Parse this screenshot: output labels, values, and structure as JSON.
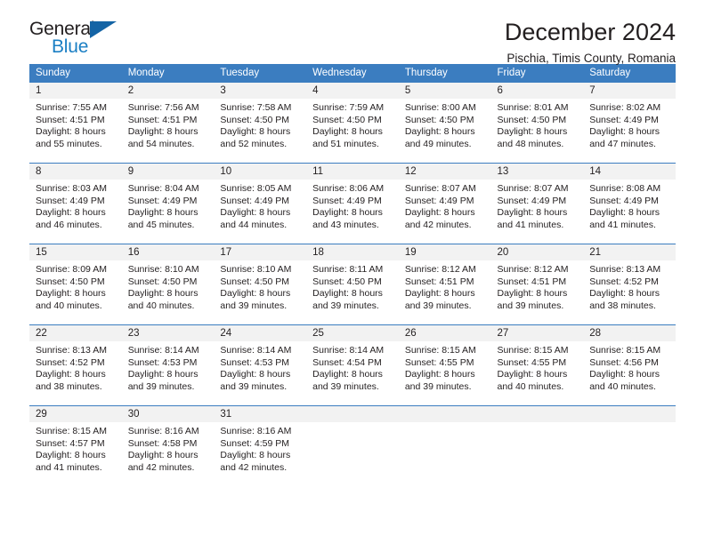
{
  "brand": {
    "name_primary": "General",
    "name_secondary": "Blue",
    "triangle_color": "#1464a5"
  },
  "header": {
    "title": "December 2024",
    "subtitle": "Pischia, Timis County, Romania"
  },
  "theme": {
    "header_bar_color": "#3b7dc0",
    "daynum_band_color": "#f2f2f2",
    "text_color": "#231f20"
  },
  "weekdays": [
    "Sunday",
    "Monday",
    "Tuesday",
    "Wednesday",
    "Thursday",
    "Friday",
    "Saturday"
  ],
  "weeks": [
    [
      {
        "day": "1",
        "sunrise": "Sunrise: 7:55 AM",
        "sunset": "Sunset: 4:51 PM",
        "daylight1": "Daylight: 8 hours",
        "daylight2": "and 55 minutes."
      },
      {
        "day": "2",
        "sunrise": "Sunrise: 7:56 AM",
        "sunset": "Sunset: 4:51 PM",
        "daylight1": "Daylight: 8 hours",
        "daylight2": "and 54 minutes."
      },
      {
        "day": "3",
        "sunrise": "Sunrise: 7:58 AM",
        "sunset": "Sunset: 4:50 PM",
        "daylight1": "Daylight: 8 hours",
        "daylight2": "and 52 minutes."
      },
      {
        "day": "4",
        "sunrise": "Sunrise: 7:59 AM",
        "sunset": "Sunset: 4:50 PM",
        "daylight1": "Daylight: 8 hours",
        "daylight2": "and 51 minutes."
      },
      {
        "day": "5",
        "sunrise": "Sunrise: 8:00 AM",
        "sunset": "Sunset: 4:50 PM",
        "daylight1": "Daylight: 8 hours",
        "daylight2": "and 49 minutes."
      },
      {
        "day": "6",
        "sunrise": "Sunrise: 8:01 AM",
        "sunset": "Sunset: 4:50 PM",
        "daylight1": "Daylight: 8 hours",
        "daylight2": "and 48 minutes."
      },
      {
        "day": "7",
        "sunrise": "Sunrise: 8:02 AM",
        "sunset": "Sunset: 4:49 PM",
        "daylight1": "Daylight: 8 hours",
        "daylight2": "and 47 minutes."
      }
    ],
    [
      {
        "day": "8",
        "sunrise": "Sunrise: 8:03 AM",
        "sunset": "Sunset: 4:49 PM",
        "daylight1": "Daylight: 8 hours",
        "daylight2": "and 46 minutes."
      },
      {
        "day": "9",
        "sunrise": "Sunrise: 8:04 AM",
        "sunset": "Sunset: 4:49 PM",
        "daylight1": "Daylight: 8 hours",
        "daylight2": "and 45 minutes."
      },
      {
        "day": "10",
        "sunrise": "Sunrise: 8:05 AM",
        "sunset": "Sunset: 4:49 PM",
        "daylight1": "Daylight: 8 hours",
        "daylight2": "and 44 minutes."
      },
      {
        "day": "11",
        "sunrise": "Sunrise: 8:06 AM",
        "sunset": "Sunset: 4:49 PM",
        "daylight1": "Daylight: 8 hours",
        "daylight2": "and 43 minutes."
      },
      {
        "day": "12",
        "sunrise": "Sunrise: 8:07 AM",
        "sunset": "Sunset: 4:49 PM",
        "daylight1": "Daylight: 8 hours",
        "daylight2": "and 42 minutes."
      },
      {
        "day": "13",
        "sunrise": "Sunrise: 8:07 AM",
        "sunset": "Sunset: 4:49 PM",
        "daylight1": "Daylight: 8 hours",
        "daylight2": "and 41 minutes."
      },
      {
        "day": "14",
        "sunrise": "Sunrise: 8:08 AM",
        "sunset": "Sunset: 4:49 PM",
        "daylight1": "Daylight: 8 hours",
        "daylight2": "and 41 minutes."
      }
    ],
    [
      {
        "day": "15",
        "sunrise": "Sunrise: 8:09 AM",
        "sunset": "Sunset: 4:50 PM",
        "daylight1": "Daylight: 8 hours",
        "daylight2": "and 40 minutes."
      },
      {
        "day": "16",
        "sunrise": "Sunrise: 8:10 AM",
        "sunset": "Sunset: 4:50 PM",
        "daylight1": "Daylight: 8 hours",
        "daylight2": "and 40 minutes."
      },
      {
        "day": "17",
        "sunrise": "Sunrise: 8:10 AM",
        "sunset": "Sunset: 4:50 PM",
        "daylight1": "Daylight: 8 hours",
        "daylight2": "and 39 minutes."
      },
      {
        "day": "18",
        "sunrise": "Sunrise: 8:11 AM",
        "sunset": "Sunset: 4:50 PM",
        "daylight1": "Daylight: 8 hours",
        "daylight2": "and 39 minutes."
      },
      {
        "day": "19",
        "sunrise": "Sunrise: 8:12 AM",
        "sunset": "Sunset: 4:51 PM",
        "daylight1": "Daylight: 8 hours",
        "daylight2": "and 39 minutes."
      },
      {
        "day": "20",
        "sunrise": "Sunrise: 8:12 AM",
        "sunset": "Sunset: 4:51 PM",
        "daylight1": "Daylight: 8 hours",
        "daylight2": "and 39 minutes."
      },
      {
        "day": "21",
        "sunrise": "Sunrise: 8:13 AM",
        "sunset": "Sunset: 4:52 PM",
        "daylight1": "Daylight: 8 hours",
        "daylight2": "and 38 minutes."
      }
    ],
    [
      {
        "day": "22",
        "sunrise": "Sunrise: 8:13 AM",
        "sunset": "Sunset: 4:52 PM",
        "daylight1": "Daylight: 8 hours",
        "daylight2": "and 38 minutes."
      },
      {
        "day": "23",
        "sunrise": "Sunrise: 8:14 AM",
        "sunset": "Sunset: 4:53 PM",
        "daylight1": "Daylight: 8 hours",
        "daylight2": "and 39 minutes."
      },
      {
        "day": "24",
        "sunrise": "Sunrise: 8:14 AM",
        "sunset": "Sunset: 4:53 PM",
        "daylight1": "Daylight: 8 hours",
        "daylight2": "and 39 minutes."
      },
      {
        "day": "25",
        "sunrise": "Sunrise: 8:14 AM",
        "sunset": "Sunset: 4:54 PM",
        "daylight1": "Daylight: 8 hours",
        "daylight2": "and 39 minutes."
      },
      {
        "day": "26",
        "sunrise": "Sunrise: 8:15 AM",
        "sunset": "Sunset: 4:55 PM",
        "daylight1": "Daylight: 8 hours",
        "daylight2": "and 39 minutes."
      },
      {
        "day": "27",
        "sunrise": "Sunrise: 8:15 AM",
        "sunset": "Sunset: 4:55 PM",
        "daylight1": "Daylight: 8 hours",
        "daylight2": "and 40 minutes."
      },
      {
        "day": "28",
        "sunrise": "Sunrise: 8:15 AM",
        "sunset": "Sunset: 4:56 PM",
        "daylight1": "Daylight: 8 hours",
        "daylight2": "and 40 minutes."
      }
    ],
    [
      {
        "day": "29",
        "sunrise": "Sunrise: 8:15 AM",
        "sunset": "Sunset: 4:57 PM",
        "daylight1": "Daylight: 8 hours",
        "daylight2": "and 41 minutes."
      },
      {
        "day": "30",
        "sunrise": "Sunrise: 8:16 AM",
        "sunset": "Sunset: 4:58 PM",
        "daylight1": "Daylight: 8 hours",
        "daylight2": "and 42 minutes."
      },
      {
        "day": "31",
        "sunrise": "Sunrise: 8:16 AM",
        "sunset": "Sunset: 4:59 PM",
        "daylight1": "Daylight: 8 hours",
        "daylight2": "and 42 minutes."
      },
      {
        "day": "",
        "sunrise": "",
        "sunset": "",
        "daylight1": "",
        "daylight2": ""
      },
      {
        "day": "",
        "sunrise": "",
        "sunset": "",
        "daylight1": "",
        "daylight2": ""
      },
      {
        "day": "",
        "sunrise": "",
        "sunset": "",
        "daylight1": "",
        "daylight2": ""
      },
      {
        "day": "",
        "sunrise": "",
        "sunset": "",
        "daylight1": "",
        "daylight2": ""
      }
    ]
  ]
}
